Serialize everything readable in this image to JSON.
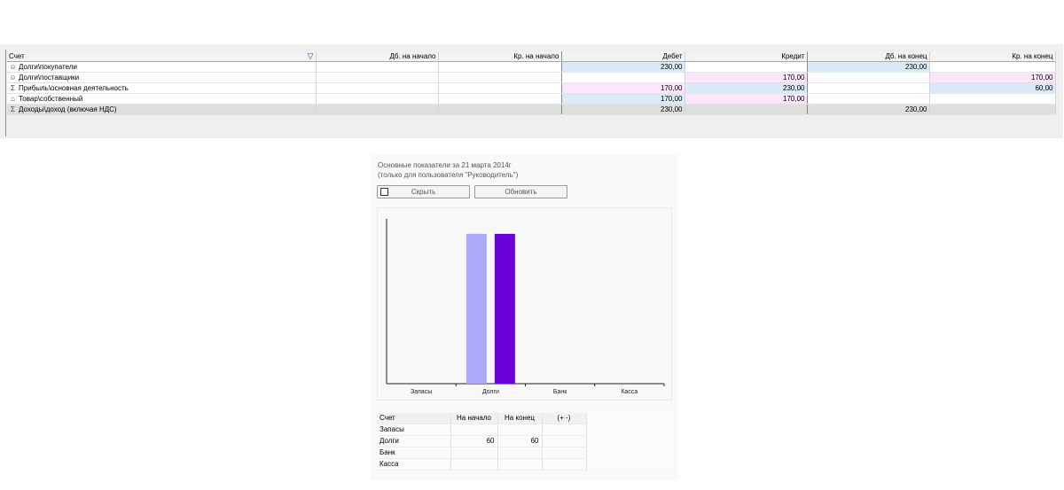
{
  "grid": {
    "columns": [
      "Счет",
      "Дб. на начало",
      "Кр. на начало",
      "Дебет",
      "Кредит",
      "Дб. на конец",
      "Кр. на конец"
    ],
    "rows": [
      {
        "icon": "person-icon",
        "account": "Долги\\покупатели",
        "db_start": "",
        "kr_start": "",
        "debit": "230,00",
        "credit": "",
        "db_end": "230,00",
        "kr_end": ""
      },
      {
        "icon": "person-icon",
        "account": "Долги\\поставщики",
        "db_start": "",
        "kr_start": "",
        "debit": "",
        "credit": "170,00",
        "db_end": "",
        "kr_end": "170,00"
      },
      {
        "icon": "sigma-icon",
        "account": "Прибыль\\основная деятельность",
        "db_start": "",
        "kr_start": "",
        "debit": "170,00",
        "credit": "230,00",
        "db_end": "",
        "kr_end": "60,00"
      },
      {
        "icon": "house-icon",
        "account": "Товар\\собственный",
        "db_start": "",
        "kr_start": "",
        "debit": "170,00",
        "credit": "170,00",
        "db_end": "",
        "kr_end": ""
      },
      {
        "icon": "sigma-icon",
        "account": "Доходы\\доход (включая НДС)",
        "db_start": "",
        "kr_start": "",
        "debit": "230,00",
        "credit": "",
        "db_end": "230,00",
        "kr_end": ""
      }
    ]
  },
  "dashboard": {
    "title": "Основные показатели за 21 марта 2014г",
    "subtitle": "(только для пользователя \"Руководитель\")",
    "hide_label": "Скрыть",
    "hide_checked": false,
    "refresh_label": "Обновить",
    "table": {
      "headers": [
        "Счет",
        "На начало",
        "На конец",
        "(+ -)"
      ],
      "rows": [
        {
          "account": "Запасы",
          "start": "",
          "end": "",
          "diff": ""
        },
        {
          "account": "Долги",
          "start": "60",
          "end": "60",
          "diff": ""
        },
        {
          "account": "Банк",
          "start": "",
          "end": "",
          "diff": ""
        },
        {
          "account": "Касса",
          "start": "",
          "end": "",
          "diff": ""
        }
      ]
    }
  },
  "chart_data": {
    "type": "bar",
    "categories": [
      "Запасы",
      "Долги",
      "Банк",
      "Касса"
    ],
    "series": [
      {
        "values": [
          0,
          60,
          0,
          0
        ],
        "color": "#aaaaf8"
      },
      {
        "values": [
          0,
          60,
          0,
          0
        ],
        "color": "#6c00d8"
      }
    ],
    "ylim": [
      0,
      66
    ],
    "grid": false,
    "title": "",
    "xlabel": "",
    "ylabel": ""
  }
}
